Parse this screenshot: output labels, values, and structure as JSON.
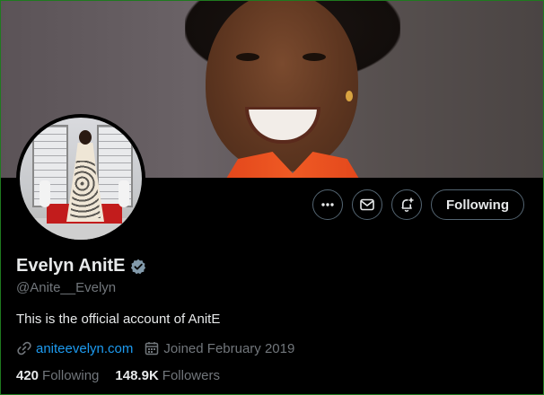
{
  "profile": {
    "display_name": "Evelyn AnitE",
    "handle": "@Anite__Evelyn",
    "verified": true,
    "verified_color": "#71767b",
    "bio": "This is the official account of AnitE",
    "website": "aniteevelyn.com",
    "joined": "Joined February 2019"
  },
  "actions": {
    "more_icon": "more-icon",
    "message_icon": "mail-icon",
    "notify_icon": "bell-plus-icon",
    "following_label": "Following"
  },
  "stats": {
    "following_count": "420",
    "following_label": "Following",
    "followers_count": "148.9K",
    "followers_label": "Followers"
  },
  "colors": {
    "background": "#000000",
    "text_primary": "#e7e9ea",
    "text_secondary": "#71767b",
    "link": "#1d9bf0",
    "border": "#536471"
  }
}
